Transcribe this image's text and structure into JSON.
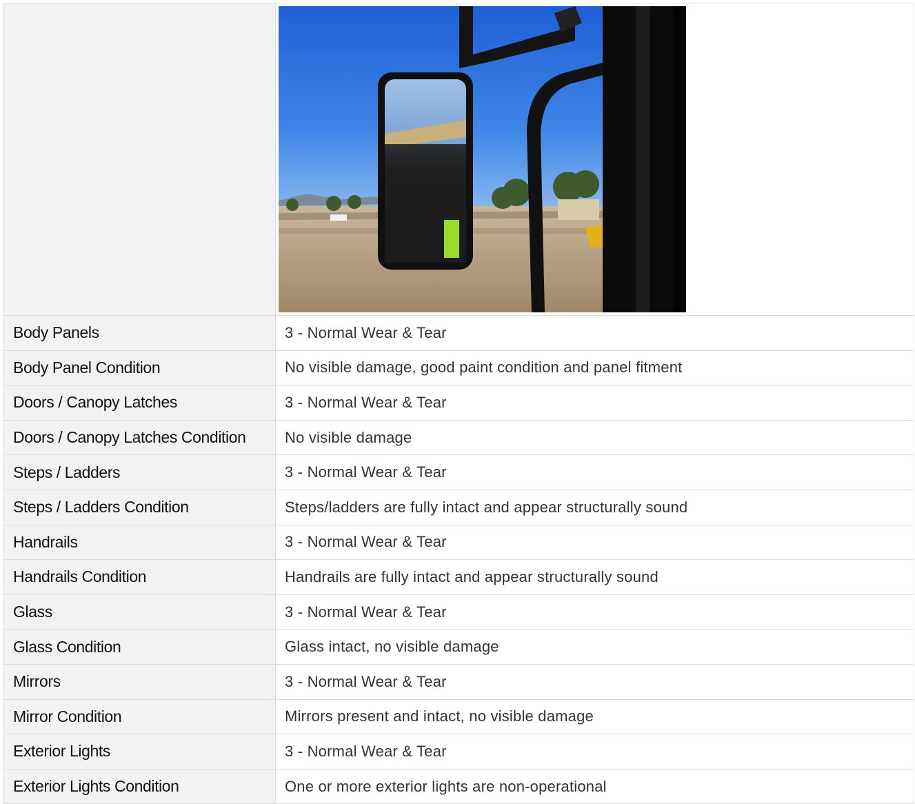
{
  "rows": [
    {
      "label": "Body Panels",
      "value": "3 - Normal Wear & Tear"
    },
    {
      "label": "Body Panel Condition",
      "value": "No visible damage, good paint condition and panel fitment"
    },
    {
      "label": "Doors / Canopy Latches",
      "value": "3 - Normal Wear & Tear"
    },
    {
      "label": "Doors / Canopy Latches Condition",
      "value": "No visible damage"
    },
    {
      "label": "Steps / Ladders",
      "value": "3 - Normal Wear & Tear"
    },
    {
      "label": "Steps / Ladders Condition",
      "value": "Steps/ladders are fully intact and appear structurally sound"
    },
    {
      "label": "Handrails",
      "value": "3 - Normal Wear & Tear"
    },
    {
      "label": "Handrails Condition",
      "value": "Handrails are fully intact and appear structurally sound"
    },
    {
      "label": "Glass",
      "value": "3 - Normal Wear & Tear"
    },
    {
      "label": "Glass Condition",
      "value": "Glass intact, no visible damage"
    },
    {
      "label": "Mirrors",
      "value": "3 - Normal Wear & Tear"
    },
    {
      "label": "Mirror Condition",
      "value": "Mirrors present and intact, no visible damage"
    },
    {
      "label": "Exterior Lights",
      "value": "3 - Normal Wear & Tear"
    },
    {
      "label": "Exterior Lights Condition",
      "value": "One or more exterior lights are non-operational"
    }
  ]
}
